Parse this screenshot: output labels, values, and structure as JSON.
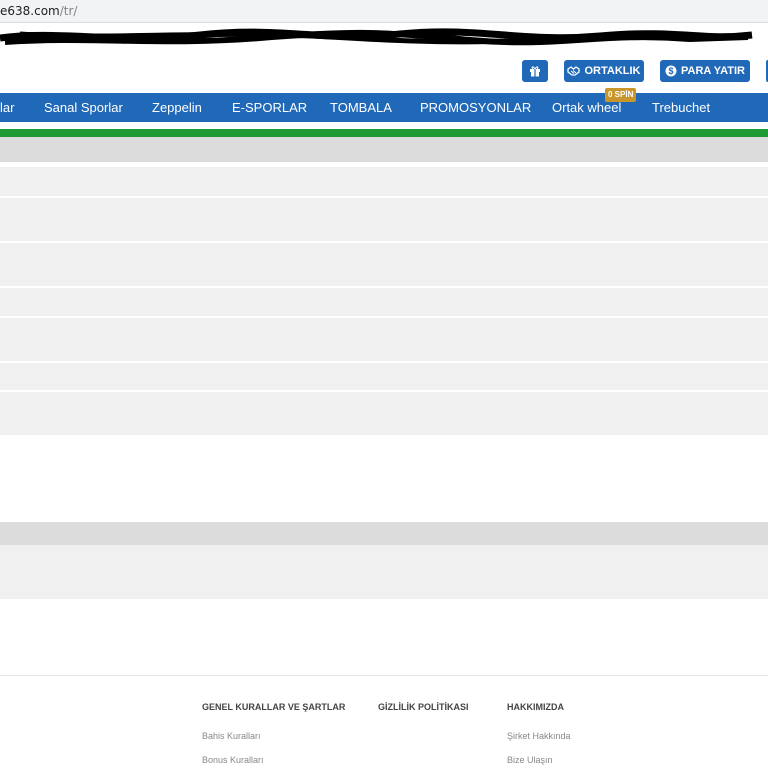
{
  "address_bar": {
    "domain": "e638.com",
    "path": "/tr/"
  },
  "header": {
    "ortaklik_label": "ORTAKLIK",
    "para_yatir_label": "PARA YATIR"
  },
  "nav": {
    "items": [
      {
        "label": "lar"
      },
      {
        "label": "Sanal Sporlar"
      },
      {
        "label": "Zeppelin"
      },
      {
        "label": "E-SPORLAR"
      },
      {
        "label": "TOMBALA"
      },
      {
        "label": "PROMOSYONLAR"
      },
      {
        "label": "Ortak wheel"
      },
      {
        "label": "Trebuchet"
      }
    ],
    "spin_badge": "0 SPİN"
  },
  "footer": {
    "col1": {
      "title": "GENEL KURALLAR VE ŞARTLAR",
      "links": [
        "Bahis Kuralları",
        "Bonus Kuralları"
      ]
    },
    "col2": {
      "title": "GİZLİLİK POLİTİKASI"
    },
    "col3": {
      "title": "HAKKIMIZDA",
      "links": [
        "Şirket Hakkında",
        "Bize Ulaşın"
      ]
    }
  },
  "colors": {
    "primary": "#2068b8",
    "green_strip": "#1e9b35",
    "badge": "#c9962a"
  }
}
